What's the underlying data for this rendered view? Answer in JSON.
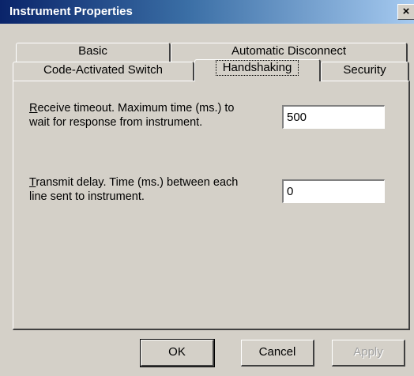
{
  "window": {
    "title": "Instrument Properties",
    "close_glyph": "×"
  },
  "tabs": {
    "row_back": [
      {
        "label": "Basic"
      },
      {
        "label": "Automatic Disconnect"
      }
    ],
    "row_front": [
      {
        "label": "Code-Activated Switch"
      },
      {
        "label": "Handshaking",
        "active": true
      },
      {
        "label": "Security"
      }
    ]
  },
  "panel": {
    "receive_timeout": {
      "accel": "R",
      "label_line1_rest": "eceive timeout. Maximum time (ms.) to",
      "label_line2": "wait for response from instrument.",
      "value": "500"
    },
    "transmit_delay": {
      "accel": "T",
      "label_line1_rest": "ransmit delay. Time (ms.) between each",
      "label_line2": "line sent to instrument.",
      "value": "0"
    }
  },
  "buttons": {
    "ok": "OK",
    "cancel": "Cancel",
    "apply": "Apply",
    "apply_enabled": false
  }
}
